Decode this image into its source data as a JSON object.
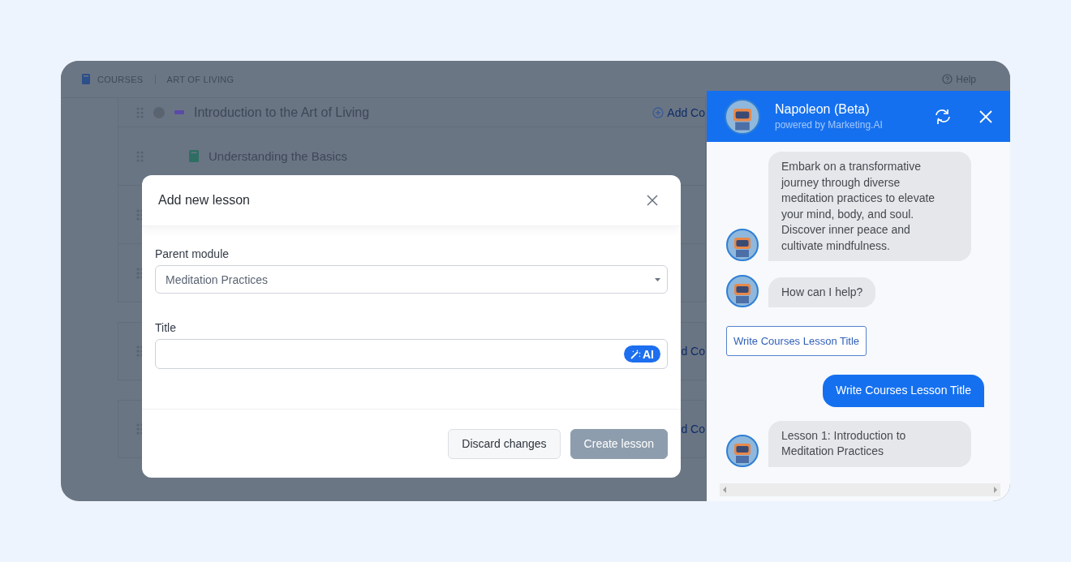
{
  "breadcrumb": [
    {
      "label": "COURSES"
    },
    {
      "label": "ART OF LIVING"
    }
  ],
  "help": "Help",
  "outline": [
    {
      "kind": "module",
      "title": "Introduction to the Art of Living",
      "action": "Add Co"
    },
    {
      "kind": "lesson",
      "title": "Understanding the Basics"
    },
    {
      "kind": "blank"
    },
    {
      "kind": "blank"
    },
    {
      "kind": "card",
      "action": "d Co"
    },
    {
      "kind": "card",
      "action": "d Co"
    }
  ],
  "modal": {
    "title": "Add new lesson",
    "fields": [
      {
        "kind": "select",
        "label": "Parent module",
        "value": "Meditation Practices"
      },
      {
        "kind": "text",
        "label": "Title",
        "ai_button": "AI"
      }
    ],
    "buttons": [
      {
        "label": "Discard changes",
        "disabled": false
      },
      {
        "label": "Create lesson",
        "disabled": true
      }
    ]
  },
  "chat": {
    "title": "Napoleon (Beta)",
    "subtitle": "powered by Marketing.AI",
    "messages": [
      {
        "kind": "bot",
        "text": "Embark on a transformative journey through diverse meditation practices to elevate your mind, body, and soul. Discover inner peace and cultivate mindfulness."
      },
      {
        "kind": "bot",
        "text": "How can I help?"
      },
      {
        "kind": "suggestion",
        "text": "Write Courses Lesson Title"
      },
      {
        "kind": "user",
        "text": "Write Courses Lesson Title"
      },
      {
        "kind": "bot",
        "text": "Lesson 1: Introduction to Meditation Practices"
      }
    ]
  }
}
